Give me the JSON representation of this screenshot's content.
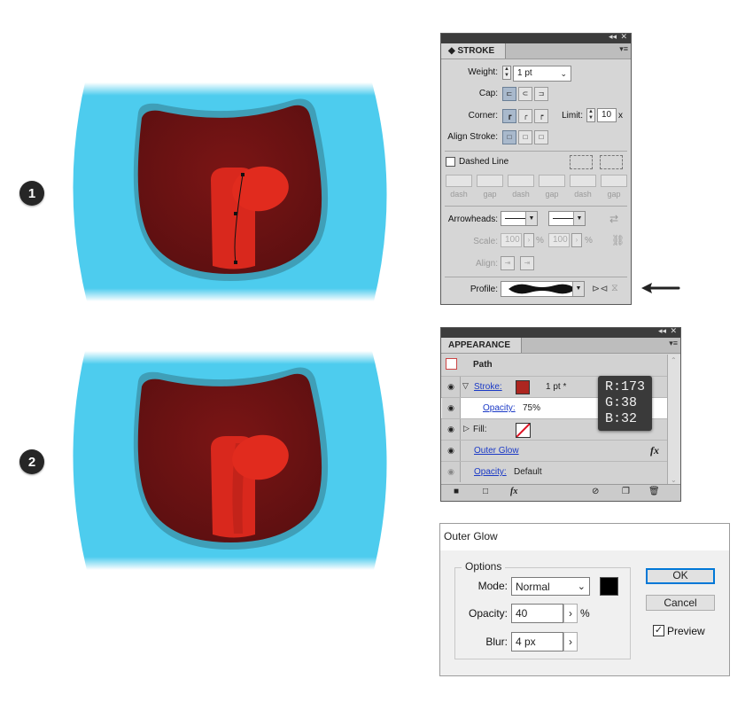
{
  "steps": [
    "1",
    "2"
  ],
  "stroke_panel": {
    "tab": "STROKE",
    "collapse_glyph": "◂◂",
    "close_glyph": "✕",
    "menu_glyph": "▾≡",
    "weight_label": "Weight:",
    "weight_value": "1 pt",
    "cap_label": "Cap:",
    "corner_label": "Corner:",
    "limit_label": "Limit:",
    "limit_value": "10",
    "limit_unit": "x",
    "align_label": "Align Stroke:",
    "dashed_label": "Dashed Line",
    "dash_fields": [
      "dash",
      "gap",
      "dash",
      "gap",
      "dash",
      "gap"
    ],
    "arrowheads_label": "Arrowheads:",
    "scale_label": "Scale:",
    "scale_values": [
      "100",
      "100"
    ],
    "percent": "%",
    "align_arrow_label": "Align:",
    "profile_label": "Profile:"
  },
  "appearance_panel": {
    "tab": "APPEARANCE",
    "collapse_glyph": "◂◂",
    "close_glyph": "✕",
    "menu_glyph": "▾≡",
    "header": "Path",
    "stroke_label": "Stroke:",
    "stroke_color": "#AD2620",
    "stroke_weight": "1 pt *",
    "opacity_label": "Opacity:",
    "opacity_value": "75%",
    "fill_label": "Fill:",
    "effect_label": "Outer Glow",
    "fx": "fx",
    "opacity2_label": "Opacity:",
    "opacity2_value": "Default"
  },
  "tooltip": {
    "r": "R:173",
    "g": "G:38",
    "b": "B:32"
  },
  "outer_glow_dialog": {
    "title": "Outer Glow",
    "options_label": "Options",
    "mode_label": "Mode:",
    "mode_value": "Normal",
    "glow_color": "#000000",
    "opacity_label": "Opacity:",
    "opacity_value": "40",
    "opacity_unit": "%",
    "blur_label": "Blur:",
    "blur_value": "4 px",
    "ok": "OK",
    "cancel": "Cancel",
    "preview_label": "Preview",
    "preview_checked": true
  },
  "colors": {
    "face_blue": "#4DCCEE",
    "mouth_dark": "#7A1516",
    "tongue_red": "#E12B1E",
    "stroke_red": "#AD2620"
  }
}
